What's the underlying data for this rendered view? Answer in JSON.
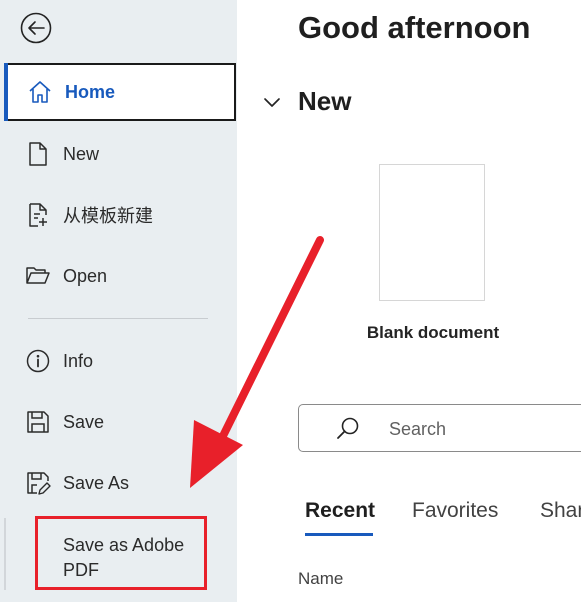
{
  "sidebar": {
    "items": [
      {
        "label": "Home",
        "icon": "home-icon"
      },
      {
        "label": "New",
        "icon": "new-document-icon"
      },
      {
        "label": "从模板新建",
        "icon": "template-document-icon"
      },
      {
        "label": "Open",
        "icon": "folder-open-icon"
      },
      {
        "label": "Info",
        "icon": "info-icon"
      },
      {
        "label": "Save",
        "icon": "save-icon"
      },
      {
        "label": "Save As",
        "icon": "save-as-icon"
      },
      {
        "label": "Save as Adobe PDF",
        "icon": ""
      }
    ]
  },
  "main": {
    "greeting": "Good afternoon",
    "new_section_title": "New",
    "blank_document_label": "Blank document",
    "search": {
      "placeholder": "Search"
    },
    "tabs": [
      {
        "label": "Recent"
      },
      {
        "label": "Favorites"
      },
      {
        "label": "Shar"
      }
    ],
    "column_header": "Name"
  },
  "colors": {
    "accent": "#185abd",
    "sidebar_bg": "#e9eef1",
    "annotation_red": "#e8202a"
  }
}
